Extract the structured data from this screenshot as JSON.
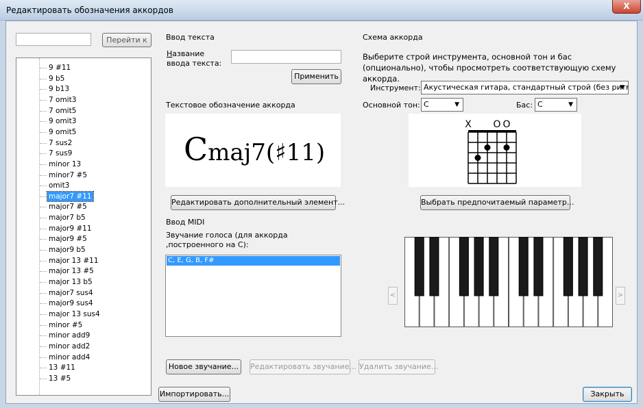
{
  "window": {
    "title": "Редактировать обозначения аккордов",
    "close_label": "X"
  },
  "left": {
    "search_value": "",
    "goto_label": "Перейти к",
    "tree_items": [
      {
        "label": "9 #11",
        "selected": false
      },
      {
        "label": "9 b5",
        "selected": false
      },
      {
        "label": "9 b13",
        "selected": false
      },
      {
        "label": "7 omit3",
        "selected": false
      },
      {
        "label": "7 omit5",
        "selected": false
      },
      {
        "label": "9 omit3",
        "selected": false
      },
      {
        "label": "9 omit5",
        "selected": false
      },
      {
        "label": "7 sus2",
        "selected": false
      },
      {
        "label": "7 sus9",
        "selected": false
      },
      {
        "label": "minor 13",
        "selected": false
      },
      {
        "label": "minor7 #5",
        "selected": false
      },
      {
        "label": "omit3",
        "selected": false
      },
      {
        "label": "major7 #11",
        "selected": true
      },
      {
        "label": "major7 #5",
        "selected": false
      },
      {
        "label": "major7 b5",
        "selected": false
      },
      {
        "label": "major9 #11",
        "selected": false
      },
      {
        "label": "major9 #5",
        "selected": false
      },
      {
        "label": "major9 b5",
        "selected": false
      },
      {
        "label": "major 13 #11",
        "selected": false
      },
      {
        "label": "major 13 #5",
        "selected": false
      },
      {
        "label": "major 13 b5",
        "selected": false
      },
      {
        "label": "major7 sus4",
        "selected": false
      },
      {
        "label": "major9 sus4",
        "selected": false
      },
      {
        "label": "major 13 sus4",
        "selected": false
      },
      {
        "label": "minor #5",
        "selected": false
      },
      {
        "label": "minor add9",
        "selected": false
      },
      {
        "label": "minor add2",
        "selected": false
      },
      {
        "label": "minor add4",
        "selected": false
      },
      {
        "label": "13 #11",
        "selected": false
      },
      {
        "label": "13 #5",
        "selected": false
      }
    ]
  },
  "text_input": {
    "section_title": "Ввод текста",
    "name_label": "Название ввода текста:",
    "name_value": "",
    "apply_label": "Применить",
    "symbol_title": "Текстовое обозначение аккорда",
    "chord_root": "C",
    "chord_rest": "maj7(♯11)",
    "edit_extra_label": "Редактировать дополнительный элемент..."
  },
  "midi": {
    "section_title": "Ввод MIDI",
    "voicing_label": "Звучание голоса (для аккорда ,построенного на С):",
    "voicings": [
      "C, E, G, B, F#"
    ],
    "new_label": "Новое звучание...",
    "edit_label": "Редактировать звучание...",
    "delete_label": "Удалить звучание..."
  },
  "diagram": {
    "section_title": "Схема аккорда",
    "description": "Выберите строй инструмента, основной тон и бас (опционально), чтобы просмотреть соответствующую схему аккорда.",
    "instrument_label": "Инструмент:",
    "instrument_value": "Акустическая гитара, стандартный строй (без ритм",
    "root_label": "Основной тон:",
    "root_value": "C",
    "bass_label": "Бас:",
    "bass_value": "C",
    "string_markers": [
      "X",
      "",
      "",
      "O",
      "O",
      ""
    ],
    "choose_label": "Выбрать предпочитаемый параметр...",
    "scroll_left": "<",
    "scroll_right": ">"
  },
  "footer": {
    "import_label": "Импортировать...",
    "close_label": "Закрыть"
  }
}
